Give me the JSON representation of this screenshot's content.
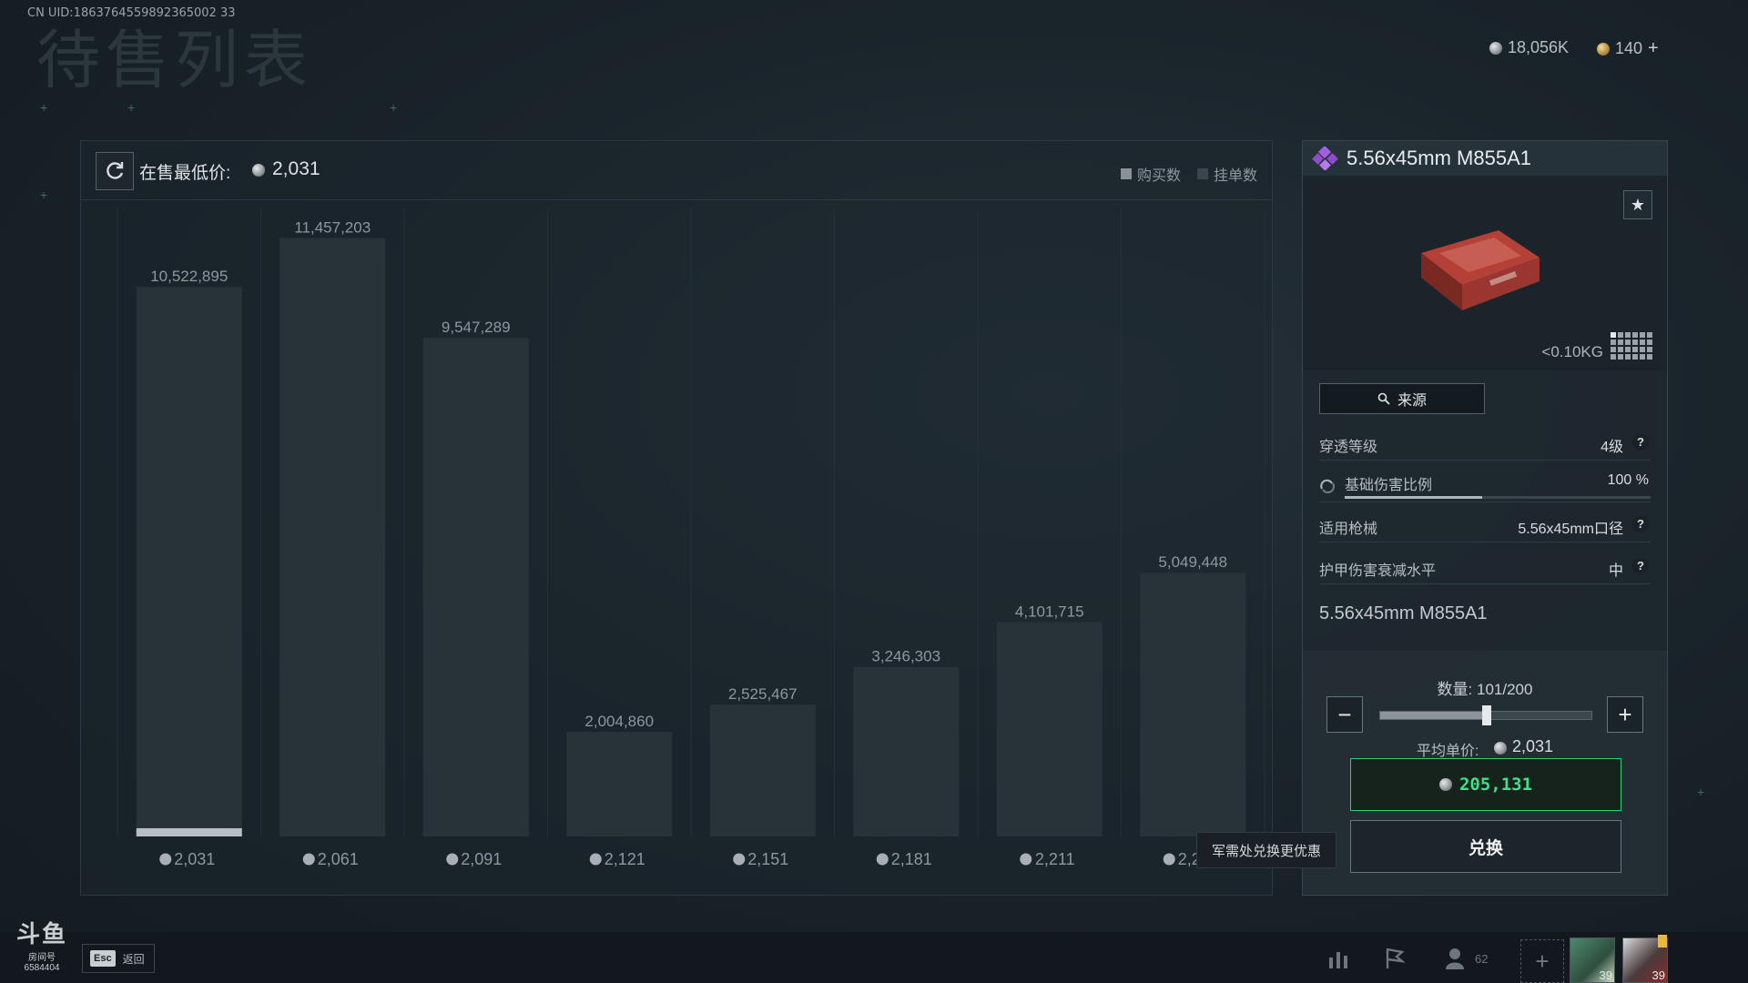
{
  "header": {
    "uid": "CN UID:1863764559892365002 33",
    "title": "待售列表",
    "currency_silver": "18,056K",
    "currency_gold": "140"
  },
  "chart_panel": {
    "min_price_label": "在售最低价:",
    "min_price_value": "2,031",
    "legend": [
      {
        "label": "购买数",
        "color": "#8a9298"
      },
      {
        "label": "挂单数",
        "color": "#3a454c"
      }
    ]
  },
  "chart_data": {
    "type": "bar",
    "categories": [
      "2,031",
      "2,061",
      "2,091",
      "2,121",
      "2,151",
      "2,181",
      "2,211",
      "2,241"
    ],
    "series": [
      {
        "values": [
          10522895,
          11457203,
          9547289,
          2004860,
          2525467,
          3246303,
          4101715,
          5049448
        ]
      }
    ],
    "value_labels": [
      "10,522,895",
      "11,457,203",
      "9,547,289",
      "2,004,860",
      "2,525,467",
      "3,246,303",
      "4,101,715",
      "5,049,448"
    ],
    "purchase_fraction_first_bar": 0.015,
    "ylim": [
      0,
      11500000
    ]
  },
  "item": {
    "name": "5.56x45mm M855A1",
    "weight": "<0.10KG",
    "source_label": "来源",
    "stats": [
      {
        "label": "穿透等级",
        "value": "4级",
        "has_help": true
      },
      {
        "label": "基础伤害比例",
        "value": "100 %",
        "has_help": false,
        "bar_fraction": 0.45
      },
      {
        "label": "适用枪械",
        "value": "5.56x45mm口径",
        "has_help": true
      },
      {
        "label": "护甲伤害衰减水平",
        "value": "中",
        "has_help": true
      }
    ],
    "description": "5.56x45mm M855A1"
  },
  "purchase": {
    "quantity_label": "数量: 101/200",
    "quantity_current": 101,
    "quantity_max": 200,
    "avg_price_label": "平均单价:",
    "avg_price_value": "2,031",
    "total_value": "205,131",
    "exchange_label": "兑换",
    "minus_label": "−",
    "plus_label": "+"
  },
  "tooltip": "军需处兑换更优惠",
  "footer": {
    "logo_text": "斗鱼",
    "logo_sub": "房间号",
    "room_number": "6584404",
    "esc_key": "Esc",
    "back_label": "返回",
    "friend_count": "62",
    "avatar1_level": "39",
    "avatar2_level": "39"
  },
  "colors": {
    "accent_green": "#3fe08a",
    "rarity_purple": "#9b59d6",
    "bar_fill": "#2a343b",
    "purchase_fill": "#b9c0c5"
  }
}
